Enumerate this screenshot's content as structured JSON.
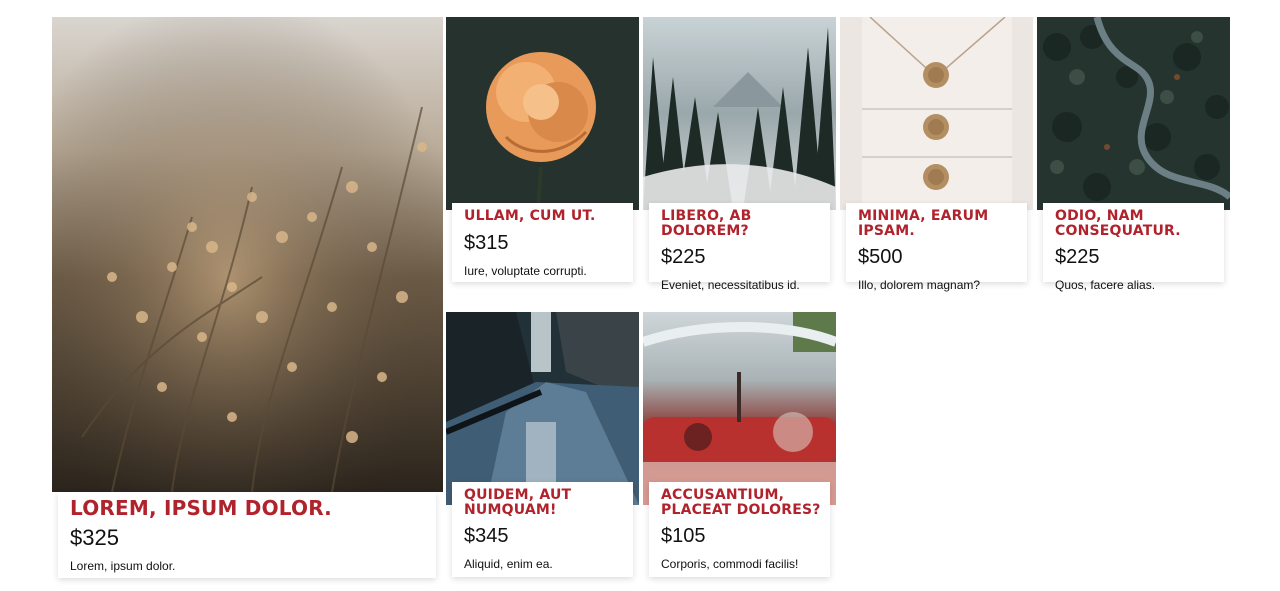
{
  "products": [
    {
      "title": "Lorem, ipsum dolor.",
      "price": "$325",
      "desc": "Lorem, ipsum dolor.",
      "image": "dried-wildflowers-photo"
    },
    {
      "title": "Ullam, cum ut.",
      "price": "$315",
      "desc": "Iure, voluptate corrupti.",
      "image": "orange-rose-photo"
    },
    {
      "title": "Libero, ab dolorem?",
      "price": "$225",
      "desc": "Eveniet, necessitatibus id.",
      "image": "snowy-forest-photo"
    },
    {
      "title": "Minima, earum ipsam.",
      "price": "$500",
      "desc": "Illo, dolorem magnam?",
      "image": "wax-seal-envelopes-photo"
    },
    {
      "title": "Odio, nam consequatur.",
      "price": "$225",
      "desc": "Quos, facere alias.",
      "image": "aerial-forest-road-photo"
    },
    {
      "title": "Quidem, aut numquam!",
      "price": "$345",
      "desc": "Aliquid, enim ea.",
      "image": "wet-city-street-photo"
    },
    {
      "title": "Accusantium, placeat dolores?",
      "price": "$105",
      "desc": "Corporis, commodi facilis!",
      "image": "vintage-car-dashboard-photo"
    }
  ],
  "colors": {
    "title": "#b1232c",
    "text": "#111111",
    "background": "#ffffff"
  }
}
